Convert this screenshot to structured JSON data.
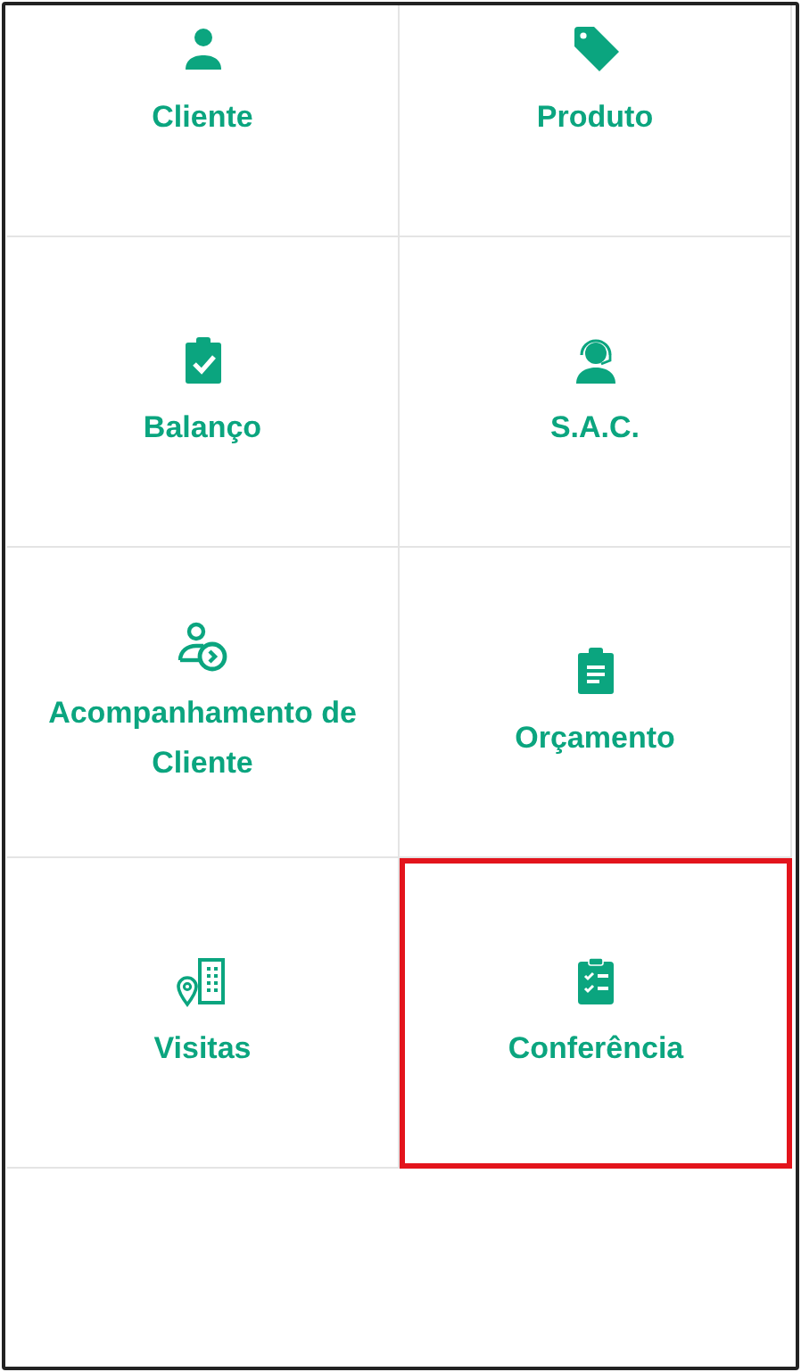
{
  "menu_items": [
    {
      "label": "Cliente",
      "kind": "person",
      "highlighted": false
    },
    {
      "label": "Produto",
      "kind": "tag",
      "highlighted": false
    },
    {
      "label": "Balanço",
      "kind": "clipboard-check",
      "highlighted": false
    },
    {
      "label": "S.A.C.",
      "kind": "headset",
      "highlighted": false
    },
    {
      "label": "Acompanhamento de Cliente",
      "kind": "person-follow",
      "highlighted": false
    },
    {
      "label": "Orçamento",
      "kind": "clipboard-text",
      "highlighted": false
    },
    {
      "label": "Visitas",
      "kind": "location-building",
      "highlighted": false
    },
    {
      "label": "Conferência",
      "kind": "clipboard-list",
      "highlighted": true
    }
  ]
}
